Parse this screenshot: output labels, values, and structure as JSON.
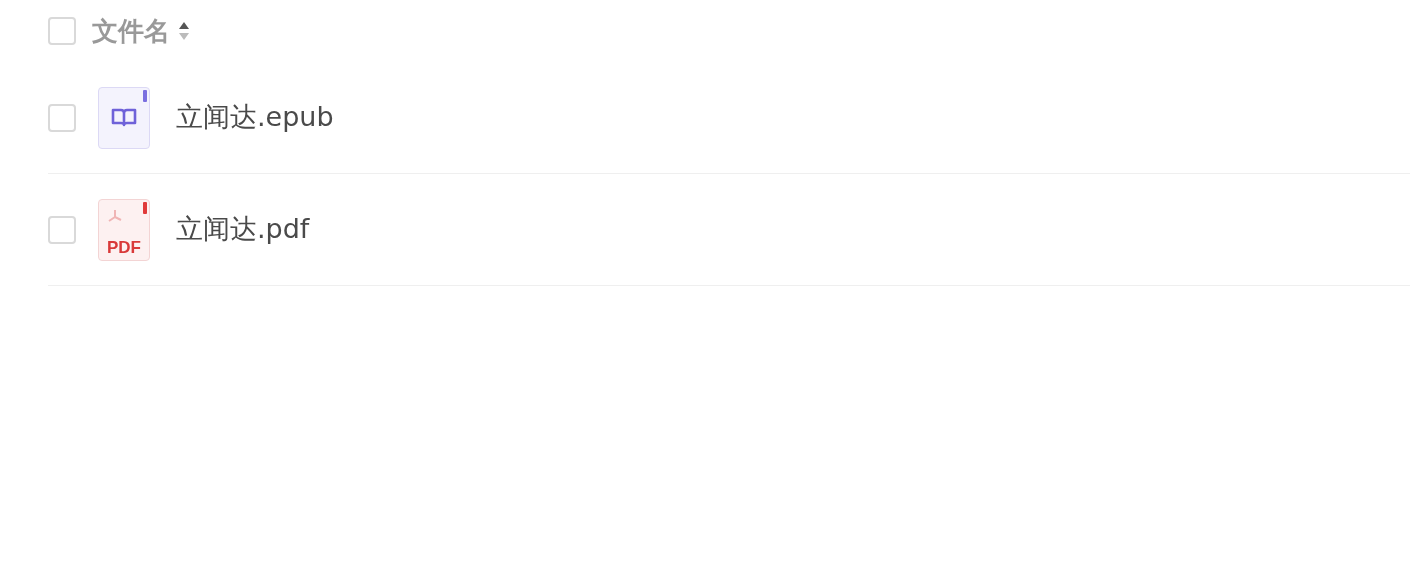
{
  "header": {
    "checked": false,
    "label": "文件名"
  },
  "files": [
    {
      "name": "立闻达.epub",
      "kind": "epub",
      "checked": false
    },
    {
      "name": "立闻达.pdf",
      "kind": "pdf",
      "icon_label": "PDF",
      "checked": false
    }
  ]
}
